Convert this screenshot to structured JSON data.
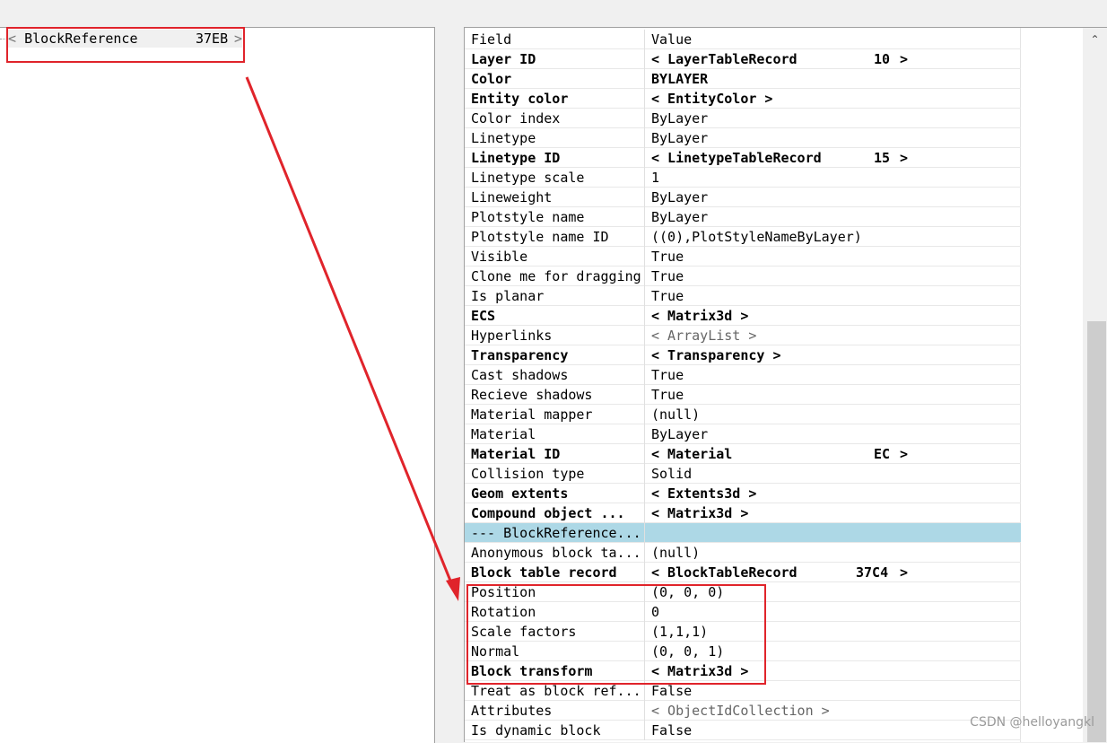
{
  "tree": {
    "node_open": "<",
    "node_label": "BlockReference",
    "node_id": "37EB",
    "node_close": ">"
  },
  "grid": {
    "header": {
      "field": "Field",
      "value": "Value"
    },
    "rows": [
      {
        "field": "Layer ID",
        "value": "< LayerTableRecord",
        "ref_id": "10",
        "bold": true
      },
      {
        "field": "Color",
        "value": "BYLAYER",
        "bold": true
      },
      {
        "field": "Entity color",
        "value": "< EntityColor >",
        "bold": true
      },
      {
        "field": "Color index",
        "value": "ByLayer"
      },
      {
        "field": "Linetype",
        "value": "ByLayer"
      },
      {
        "field": "Linetype ID",
        "value": "< LinetypeTableRecord",
        "ref_id": "15",
        "bold": true
      },
      {
        "field": "Linetype scale",
        "value": "1"
      },
      {
        "field": "Lineweight",
        "value": "ByLayer"
      },
      {
        "field": "Plotstyle name",
        "value": "ByLayer"
      },
      {
        "field": "Plotstyle name ID",
        "value": "((0),PlotStyleNameByLayer)"
      },
      {
        "field": "Visible",
        "value": "True"
      },
      {
        "field": "Clone me for dragging",
        "value": "True"
      },
      {
        "field": "Is planar",
        "value": "True"
      },
      {
        "field": "ECS",
        "value": "< Matrix3d >",
        "bold": true
      },
      {
        "field": "Hyperlinks",
        "value": "< ArrayList >",
        "gray": true
      },
      {
        "field": "Transparency",
        "value": "< Transparency >",
        "bold": true
      },
      {
        "field": "Cast shadows",
        "value": "True"
      },
      {
        "field": "Recieve shadows",
        "value": "True"
      },
      {
        "field": "Material mapper",
        "value": "(null)"
      },
      {
        "field": "Material",
        "value": "ByLayer"
      },
      {
        "field": "Material ID",
        "value": "< Material",
        "ref_id": "EC",
        "bold": true
      },
      {
        "field": "Collision type",
        "value": "Solid"
      },
      {
        "field": "Geom extents",
        "value": "< Extents3d >",
        "bold": true
      },
      {
        "field": "Compound object ...",
        "value": "< Matrix3d >",
        "bold": true
      },
      {
        "field": "--- BlockReference...",
        "value": "",
        "selected": true
      },
      {
        "field": "Anonymous block ta...",
        "value": "(null)"
      },
      {
        "field": "Block table record",
        "value": "< BlockTableRecord",
        "ref_id": "37C4",
        "bold": true
      },
      {
        "field": "Position",
        "value": "(0, 0, 0)"
      },
      {
        "field": "Rotation",
        "value": "0"
      },
      {
        "field": "Scale factors",
        "value": "(1,1,1)"
      },
      {
        "field": "Normal",
        "value": "(0, 0, 1)"
      },
      {
        "field": "Block transform",
        "value": "< Matrix3d >",
        "bold": true
      },
      {
        "field": "Treat as block ref...",
        "value": "False"
      },
      {
        "field": "Attributes",
        "value": "< ObjectIdCollection >",
        "gray": true
      },
      {
        "field": "Is dynamic block",
        "value": "False"
      }
    ]
  },
  "ref_close": ">",
  "scroll_up_glyph": "⌃",
  "watermark": "CSDN @helloyangkl",
  "colors": {
    "annotation": "#e0242b",
    "selection": "#add8e6"
  }
}
